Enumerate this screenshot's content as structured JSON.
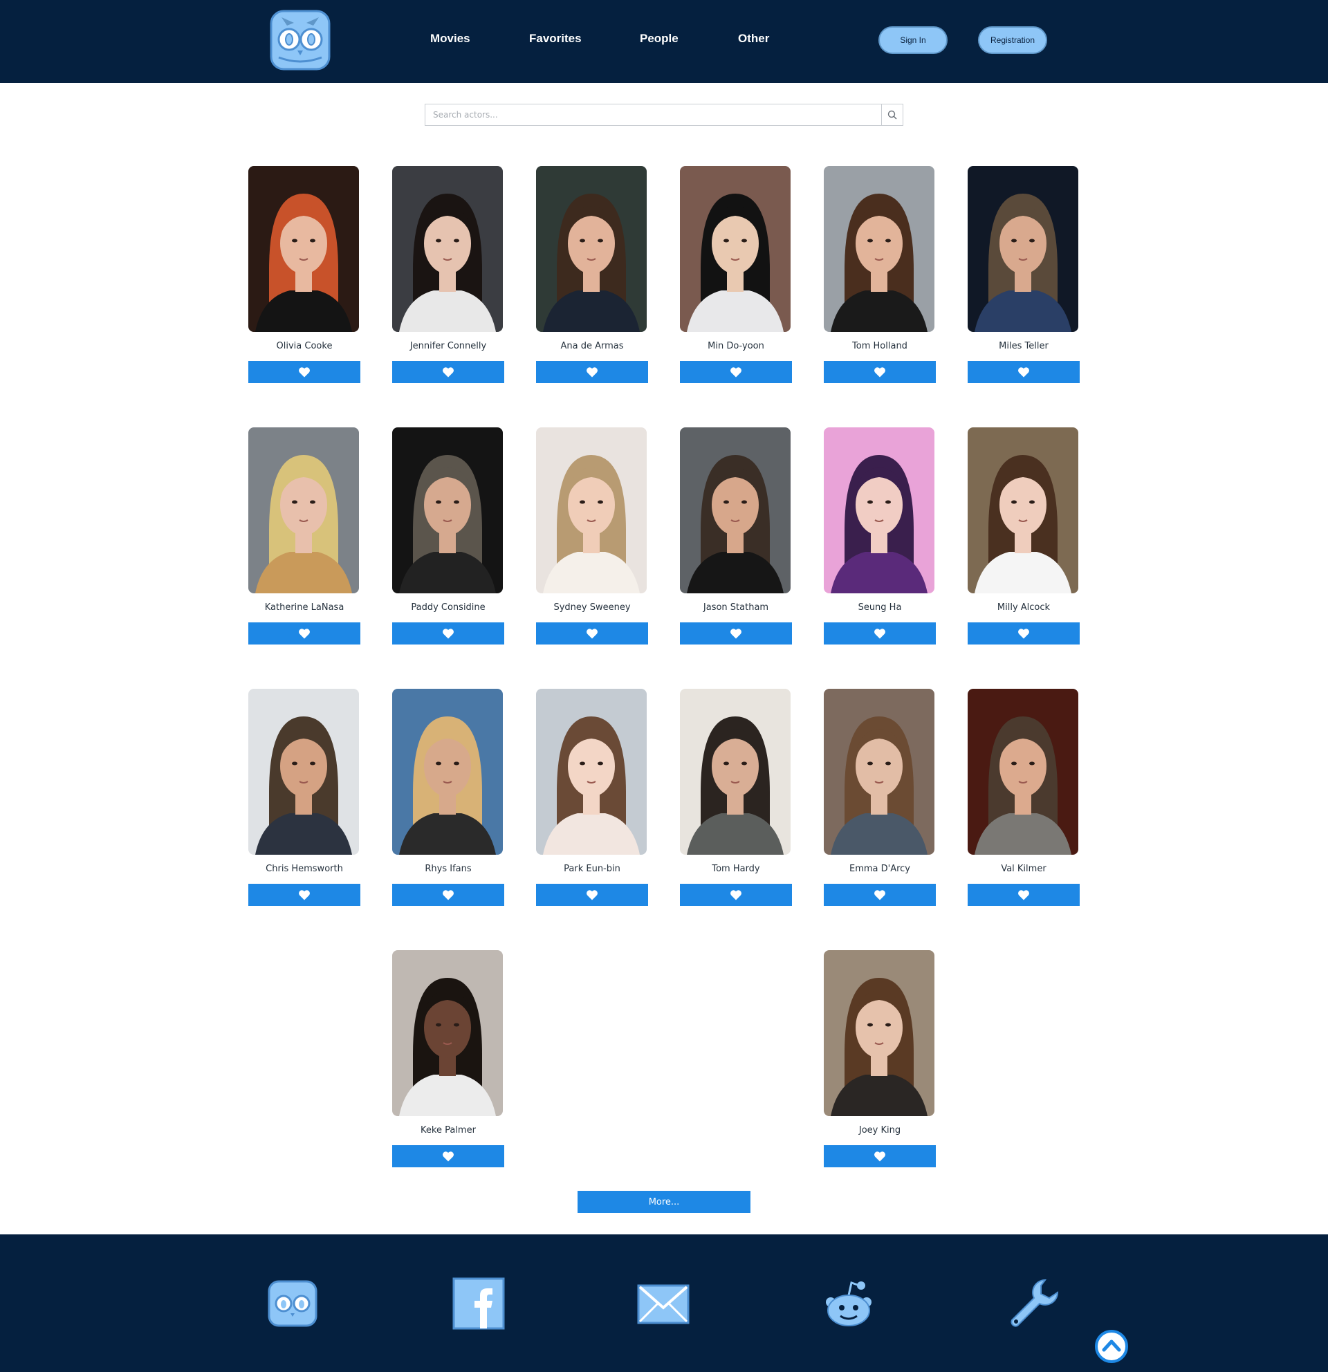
{
  "header": {
    "logo_icon": "owl-logo-icon",
    "nav": [
      "Movies",
      "Favorites",
      "People",
      "Other"
    ],
    "sign_in": "Sign In",
    "register": "Registration"
  },
  "search": {
    "placeholder": "Search actors...",
    "value": "",
    "icon": "search-icon"
  },
  "actors": [
    {
      "name": "Olivia Cooke",
      "palette": [
        "#2b1a14",
        "#c8522a",
        "#e8b9a0",
        "#141414"
      ]
    },
    {
      "name": "Jennifer Connelly",
      "palette": [
        "#3b3d42",
        "#1a1412",
        "#e6c3b0",
        "#e8e8e8"
      ]
    },
    {
      "name": "Ana de Armas",
      "palette": [
        "#2f3a36",
        "#3d2a1e",
        "#e2b39a",
        "#1b2433"
      ]
    },
    {
      "name": "Min Do-yoon",
      "palette": [
        "#7a5a4f",
        "#121212",
        "#e9c9b1",
        "#e8e8ea"
      ]
    },
    {
      "name": "Tom Holland",
      "palette": [
        "#9aa0a6",
        "#4a2e1e",
        "#e2b49a",
        "#1a1a1a"
      ]
    },
    {
      "name": "Miles Teller",
      "palette": [
        "#101826",
        "#5a4a3a",
        "#d9a98e",
        "#2a3f66"
      ]
    },
    {
      "name": "Katherine LaNasa",
      "palette": [
        "#7c8288",
        "#d8c27a",
        "#e8c0ac",
        "#c99a5a"
      ]
    },
    {
      "name": "Paddy Considine",
      "palette": [
        "#141414",
        "#5b554c",
        "#d6a98f",
        "#222222"
      ]
    },
    {
      "name": "Sydney Sweeney",
      "palette": [
        "#e9e3df",
        "#b89b72",
        "#f0cdb8",
        "#f5f0ea"
      ]
    },
    {
      "name": "Jason Statham",
      "palette": [
        "#5e6266",
        "#3a2e26",
        "#d7a78b",
        "#161616"
      ]
    },
    {
      "name": "Seung Ha",
      "palette": [
        "#e9a3d8",
        "#3a1f4d",
        "#f1cdc4",
        "#5a2a7a"
      ]
    },
    {
      "name": "Milly Alcock",
      "palette": [
        "#7d6a52",
        "#4a3020",
        "#efcdbd",
        "#f5f5f5"
      ]
    },
    {
      "name": "Chris Hemsworth",
      "palette": [
        "#dfe2e5",
        "#4a3a2c",
        "#d5a283",
        "#2c3340"
      ]
    },
    {
      "name": "Rhys Ifans",
      "palette": [
        "#4a78a6",
        "#d8b276",
        "#d7a98b",
        "#2a2a2a"
      ]
    },
    {
      "name": "Park Eun-bin",
      "palette": [
        "#c4cbd2",
        "#6a4a36",
        "#f3d6c6",
        "#f2e6e0"
      ]
    },
    {
      "name": "Tom Hardy",
      "palette": [
        "#e8e4de",
        "#2b2420",
        "#d9ae95",
        "#5b5e5c"
      ]
    },
    {
      "name": "Emma D'Arcy",
      "palette": [
        "#7d6a5e",
        "#6b4b33",
        "#e2bda6",
        "#4a5868"
      ]
    },
    {
      "name": "Val Kilmer",
      "palette": [
        "#4a1a12",
        "#4b3a2e",
        "#dcaa8e",
        "#7a7874"
      ]
    },
    {
      "name": "",
      "palette": []
    },
    {
      "name": "Keke Palmer",
      "palette": [
        "#bfb8b2",
        "#1a1410",
        "#6b4434",
        "#ececec"
      ]
    },
    {
      "name": "",
      "palette": []
    },
    {
      "name": "",
      "palette": []
    },
    {
      "name": "Joey King",
      "palette": [
        "#9a8a78",
        "#5a3a24",
        "#e6c2ac",
        "#2a2624"
      ]
    },
    {
      "name": "",
      "palette": []
    }
  ],
  "favorite_icon": "heart-icon",
  "more_label": "More...",
  "footer": {
    "icons": [
      "owl-logo-icon",
      "facebook-icon",
      "mail-icon",
      "reddit-icon",
      "wrench-icon"
    ],
    "back_to_top_icon": "chevron-up-icon"
  },
  "colors": {
    "header_bg": "#05203f",
    "accent": "#1e88e5",
    "pill_bg": "#8ec6f7"
  }
}
